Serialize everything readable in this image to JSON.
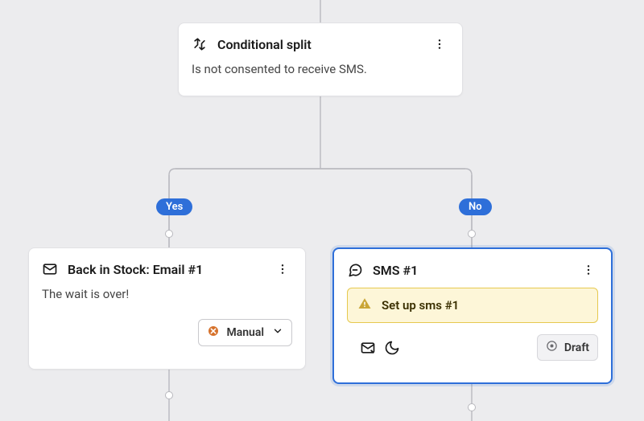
{
  "split_node": {
    "title": "Conditional split",
    "condition": "Is not consented to receive SMS."
  },
  "branches": {
    "yes_label": "Yes",
    "no_label": "No"
  },
  "email_node": {
    "title": "Back in Stock: Email #1",
    "preview": "The wait is over!",
    "manual_btn": "Manual"
  },
  "sms_node": {
    "title": "SMS #1",
    "warning": "Set up sms #1",
    "status_btn": "Draft"
  }
}
